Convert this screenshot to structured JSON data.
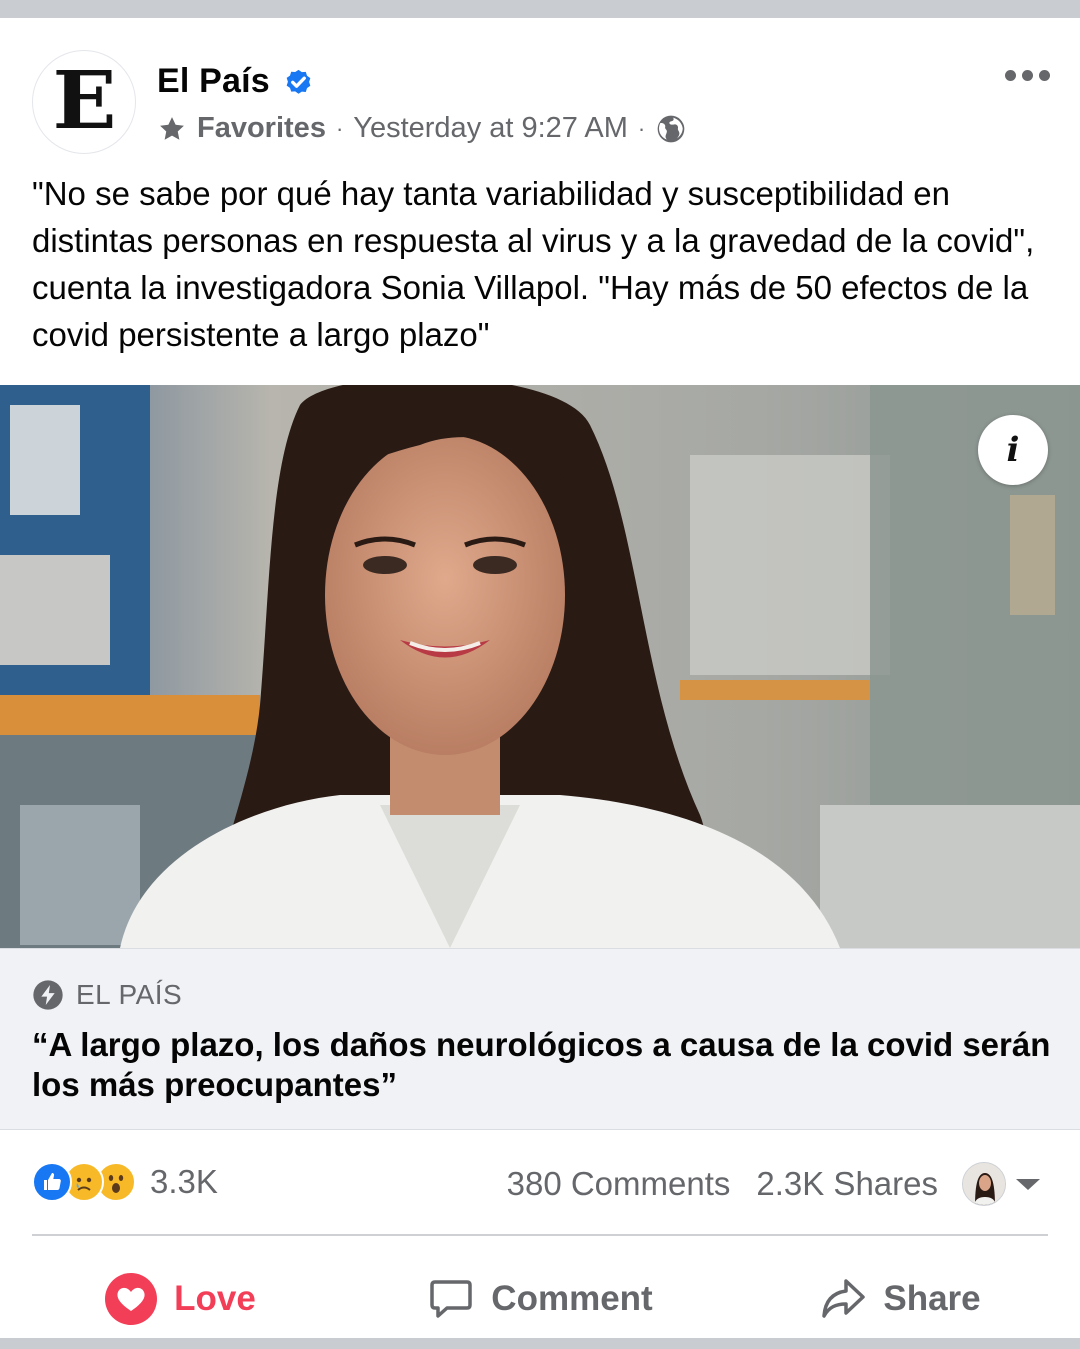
{
  "post": {
    "page_name": "El País",
    "avatar_letter": "E",
    "audience": "Favorites",
    "timestamp": "Yesterday at 9:27 AM",
    "separator": "·",
    "text": "\"No se sabe por qué hay tanta variabilidad y susceptibilidad en distintas personas en respuesta al virus y a la gravedad de la covid\", cuenta la investigadora Sonia Villapol. \"Hay más de 50 efectos de la covid persistente a largo plazo\""
  },
  "photo": {
    "info_label": "i"
  },
  "link_preview": {
    "source": "EL PAÍS",
    "headline": "“A largo plazo, los daños neurológicos a causa de la covid serán los más preocupantes”"
  },
  "stats": {
    "reactions_count": "3.3K",
    "comments": "380 Comments",
    "shares": "2.3K Shares"
  },
  "actions": {
    "love": "Love",
    "comment": "Comment",
    "share": "Share"
  },
  "colors": {
    "love": "#f33e58",
    "like_blue": "#1877f2",
    "reaction_yellow": "#f7b928",
    "muted_text": "#65676b",
    "link_bg": "#f0f2f5"
  },
  "icons": [
    "verified-badge-icon",
    "star-icon",
    "globe-icon",
    "more-icon",
    "info-icon",
    "bolt-icon",
    "like-reaction-icon",
    "sad-reaction-icon",
    "wow-reaction-icon",
    "love-heart-icon",
    "comment-icon",
    "share-icon",
    "chevron-down-icon"
  ]
}
